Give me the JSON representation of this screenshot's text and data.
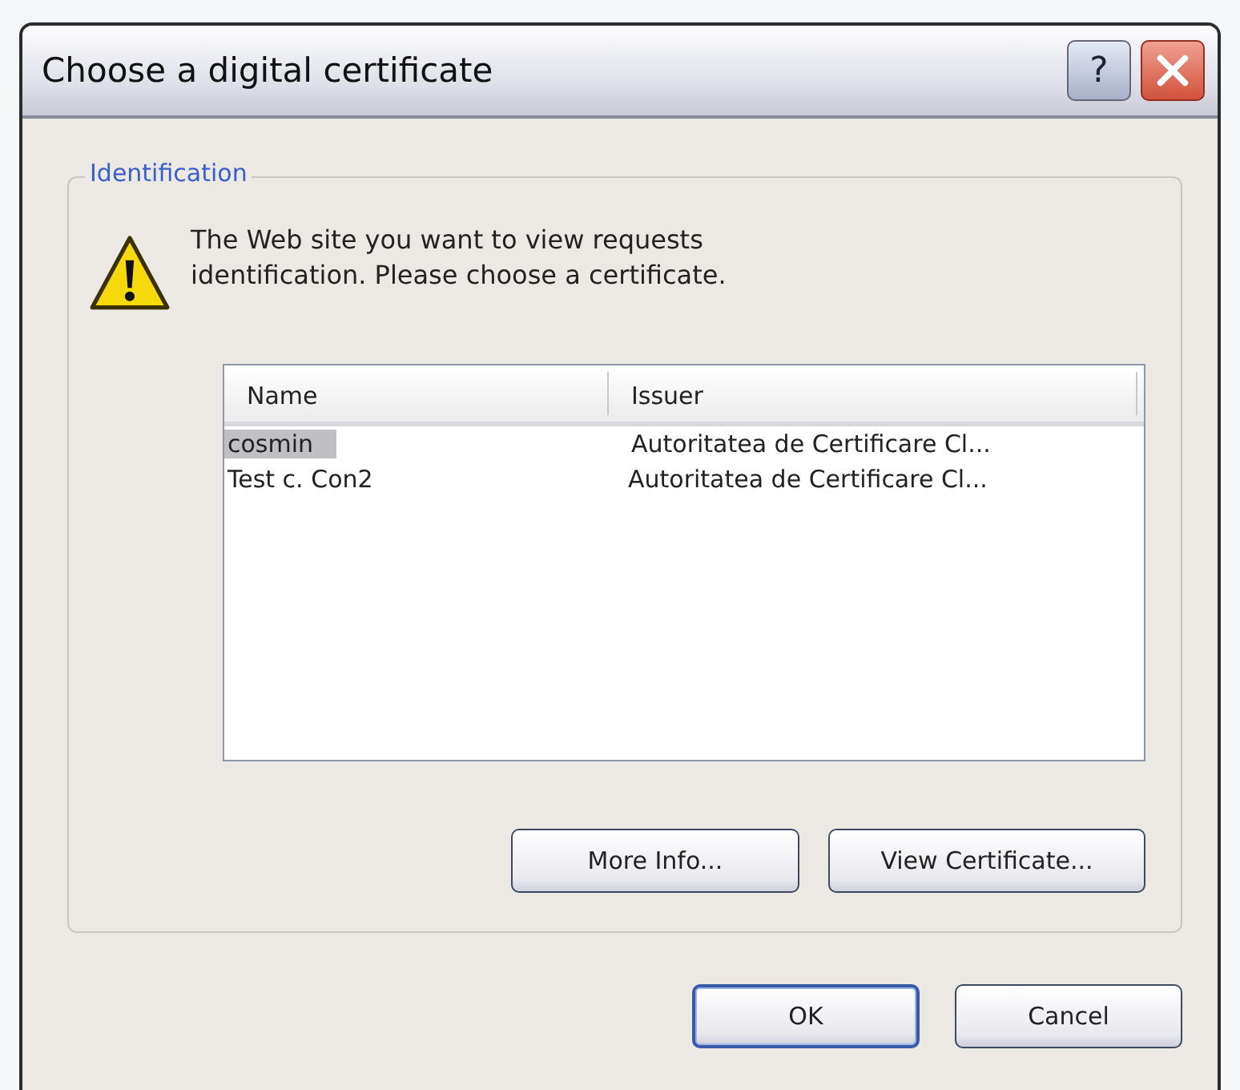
{
  "window": {
    "title": "Choose a digital certificate",
    "help_button": "?"
  },
  "group": {
    "legend": "Identification",
    "message": "The Web site you want to view requests identification. Please choose a certificate."
  },
  "table": {
    "columns": [
      "Name",
      "Issuer"
    ],
    "rows": [
      {
        "name": "cosmin",
        "issuer": "Autoritatea de Certificare Cl...",
        "selected": true
      },
      {
        "name": "Test c. Con2",
        "issuer": "Autoritatea de Certificare Cl...",
        "selected": false
      }
    ]
  },
  "group_buttons": [
    "More Info...",
    "View Certificate..."
  ],
  "buttons": [
    {
      "label": "OK",
      "default": true
    },
    {
      "label": "Cancel",
      "default": false
    }
  ]
}
